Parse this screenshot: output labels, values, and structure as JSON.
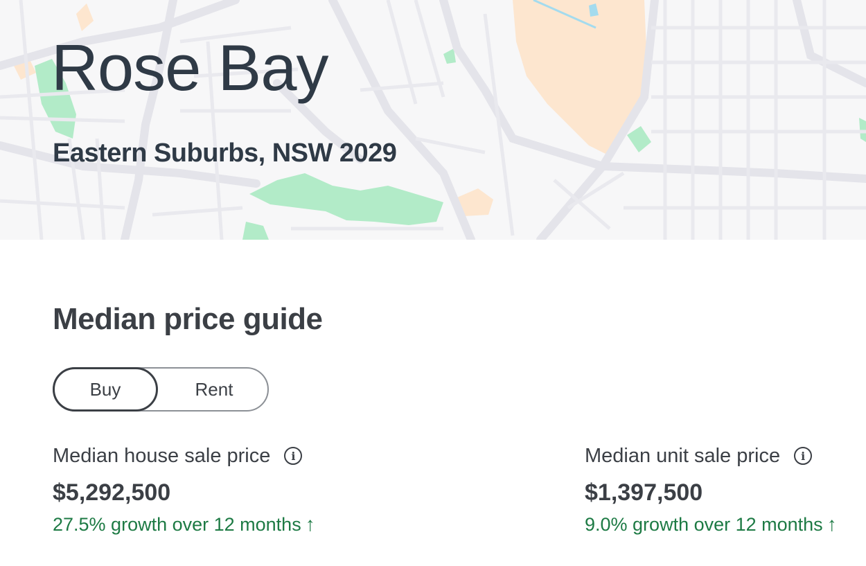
{
  "header": {
    "suburb": "Rose Bay",
    "location": "Eastern Suburbs, NSW 2029"
  },
  "map": {
    "colors": {
      "land": "#f7f7f8",
      "road": "#e4e4ea",
      "park": "#b2ebc8",
      "sand": "#fde6cf",
      "water": "#a4dbee"
    }
  },
  "median_guide": {
    "title": "Median price guide",
    "toggle": {
      "buy_label": "Buy",
      "rent_label": "Rent",
      "selected": "Buy"
    },
    "house": {
      "label": "Median house sale price",
      "value": "$5,292,500",
      "growth": "27.5% growth over 12 months",
      "info_icon": "info-icon",
      "trend_icon": "arrow-up-icon"
    },
    "unit": {
      "label": "Median unit sale price",
      "value": "$1,397,500",
      "growth": "9.0% growth over 12 months",
      "info_icon": "info-icon",
      "trend_icon": "arrow-up-icon"
    },
    "growth_color": "#1d7a44"
  }
}
